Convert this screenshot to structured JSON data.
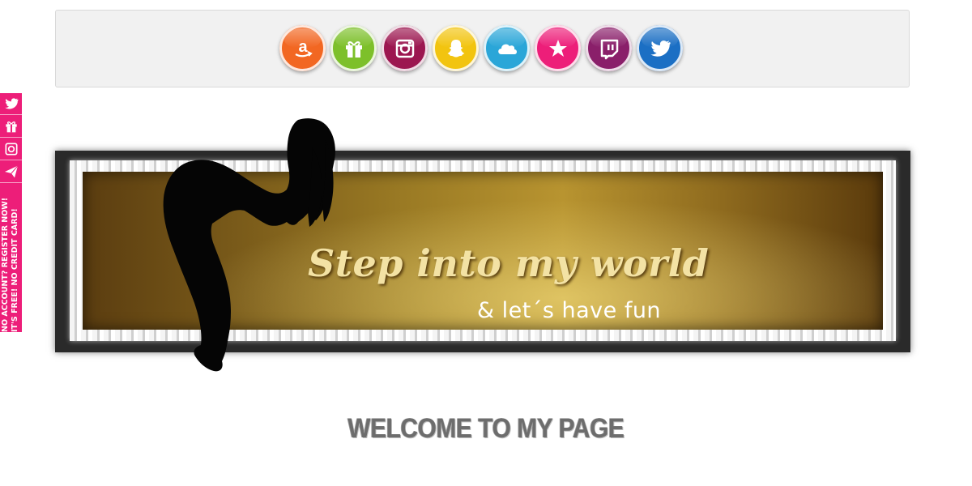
{
  "icons": [
    {
      "name": "amazon-icon",
      "color": "#f26722"
    },
    {
      "name": "gift-icon",
      "color": "#7dc02a"
    },
    {
      "name": "instagram-icon",
      "color": "#9c1750"
    },
    {
      "name": "snapchat-icon",
      "color": "#f2c40f"
    },
    {
      "name": "cloud-icon",
      "color": "#2aa6d8"
    },
    {
      "name": "star-icon",
      "color": "#ed1e79"
    },
    {
      "name": "twitch-icon",
      "color": "#8a1f6a"
    },
    {
      "name": "twitter-icon",
      "color": "#1b6fc4"
    }
  ],
  "side_bar": {
    "icons": [
      "twitter-icon",
      "gift-icon",
      "instagram-icon",
      "paper-plane-icon"
    ],
    "line1": "NO ACCOUNT? REGISTER NOW!",
    "line2": "IT'S FREE! NO CREDIT CARD!",
    "color": "#ed1e79"
  },
  "banner": {
    "title": "Step into my world",
    "subtitle": "& let´s have fun"
  },
  "welcome": "WELCOME TO MY PAGE"
}
